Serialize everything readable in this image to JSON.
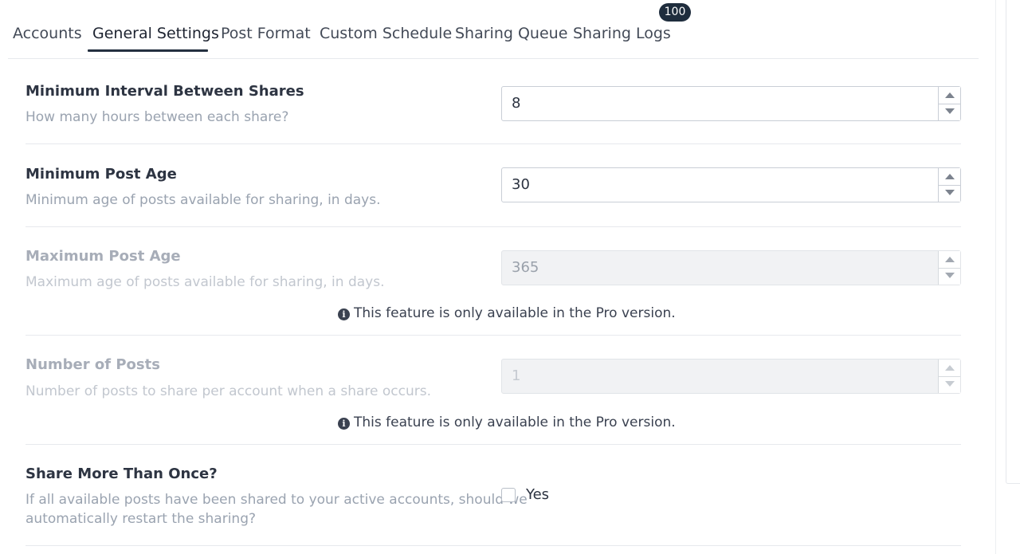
{
  "tabs": {
    "items": [
      {
        "label": "Accounts"
      },
      {
        "label": "General Settings"
      },
      {
        "label": "Post Format"
      },
      {
        "label": "Custom Schedule"
      },
      {
        "label": "Sharing Queue"
      },
      {
        "label": "Sharing Logs"
      }
    ],
    "active_index": 1,
    "sharing_logs_badge": "100"
  },
  "settings": {
    "min_interval": {
      "title": "Minimum Interval Between Shares",
      "description": "How many hours between each share?",
      "value": "8"
    },
    "min_post_age": {
      "title": "Minimum Post Age",
      "description": "Minimum age of posts available for sharing, in days.",
      "value": "30"
    },
    "max_post_age": {
      "title": "Maximum Post Age",
      "description": "Maximum age of posts available for sharing, in days.",
      "value": "365",
      "pro_note": "This feature is only available in the Pro version."
    },
    "number_of_posts": {
      "title": "Number of Posts",
      "description": "Number of posts to share per account when a share occurs.",
      "value": "1",
      "pro_note": "This feature is only available in the Pro version."
    },
    "share_more_than_once": {
      "title": "Share More Than Once?",
      "description_line1": "If all available posts have been shared to your active accounts, should we",
      "description_line2": "automatically restart the sharing?",
      "checkbox_label": "Yes",
      "checked": false
    }
  },
  "icons": {
    "info": "info-circle-icon",
    "spin_up": "caret-up-icon",
    "spin_down": "caret-down-icon"
  },
  "colors": {
    "badge_bg": "#1f2d3d",
    "active_tab_underline": "#243040",
    "muted_text": "#9aa3b0"
  }
}
